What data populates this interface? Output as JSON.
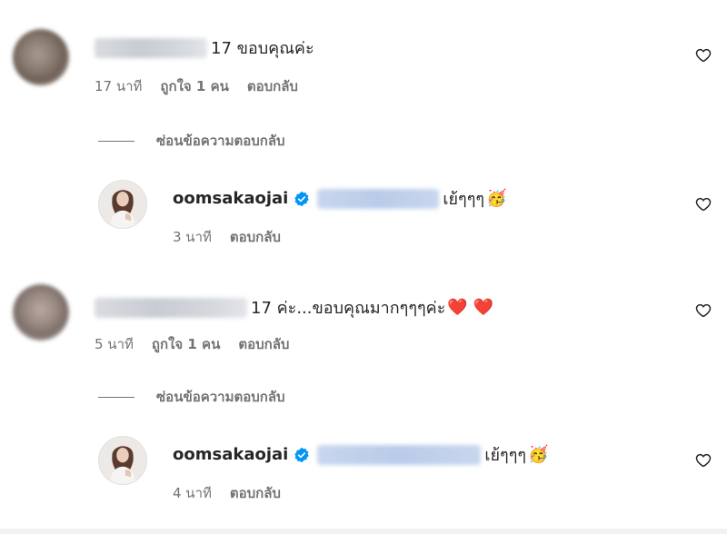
{
  "comments": [
    {
      "text": "17 ขอบคุณค่ะ",
      "time": "17 นาที",
      "likes": "ถูกใจ 1 คน",
      "reply_label": "ตอบกลับ",
      "hide_replies_label": "ซ่อนข้อความตอบกลับ",
      "reply": {
        "username": "oomsakaojai",
        "text": "เย้ๆๆๆ",
        "emoji": "🥳",
        "time": "3 นาที",
        "reply_label": "ตอบกลับ"
      }
    },
    {
      "text": "17 ค่ะ...ขอบคุณมากๆๆๆค่ะ",
      "emoji": "❤️ ❤️",
      "time": "5 นาที",
      "likes": "ถูกใจ 1 คน",
      "reply_label": "ตอบกลับ",
      "hide_replies_label": "ซ่อนข้อความตอบกลับ",
      "reply": {
        "username": "oomsakaojai",
        "text": "เย้ๆๆๆ",
        "emoji": "🥳",
        "time": "4 นาที",
        "reply_label": "ตอบกลับ"
      }
    }
  ],
  "colors": {
    "text": "#262626",
    "meta": "#737373",
    "verified": "#0095f6",
    "heart_red": "#ed4956"
  },
  "icons": {
    "like": "heart-outline-icon",
    "verified": "verified-badge-icon"
  }
}
